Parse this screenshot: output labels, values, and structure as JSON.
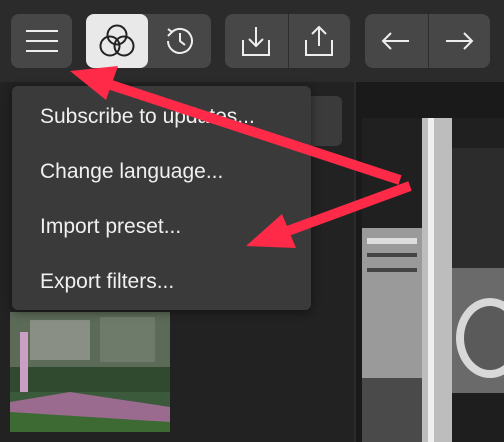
{
  "toolbar": {
    "menu_icon": "hamburger-icon",
    "filters_icon": "overlapping-circles-icon",
    "history_icon": "clock-rewind-icon",
    "import_icon": "download-tray-icon",
    "share_icon": "share-icon",
    "undo_icon": "undo-arrow-icon",
    "redo_icon": "redo-arrow-icon"
  },
  "menu": {
    "items": [
      {
        "label": "Subscribe to updates..."
      },
      {
        "label": "Change language..."
      },
      {
        "label": "Import preset..."
      },
      {
        "label": "Export filters..."
      }
    ]
  },
  "annotation": {
    "arrow_color": "#ff2a47"
  },
  "colors": {
    "toolbar_bg": "#2b2b2b",
    "button_bg": "#474747",
    "active_button_bg": "#e9e9e9",
    "menu_bg": "#3a3a3a"
  }
}
